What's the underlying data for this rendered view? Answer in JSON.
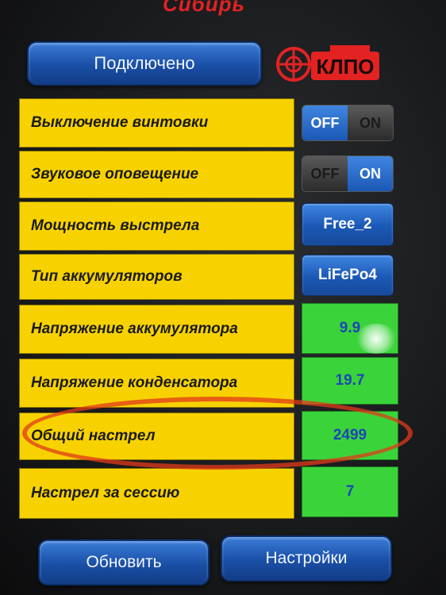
{
  "header": {
    "title": "Сибирь"
  },
  "connection": {
    "status_label": "Подключено"
  },
  "logo": {
    "text": "КЛПО"
  },
  "rows": [
    {
      "label": "Выключение винтовки",
      "type": "toggle",
      "off_label": "OFF",
      "on_label": "ON",
      "state": "off"
    },
    {
      "label": "Звуковое оповещение",
      "type": "toggle",
      "off_label": "OFF",
      "on_label": "ON",
      "state": "on"
    },
    {
      "label": "Мощность выстрела",
      "type": "button",
      "value": "Free_2"
    },
    {
      "label": "Тип аккумуляторов",
      "type": "button",
      "value": "LiFePo4"
    },
    {
      "label": "Напряжение аккумулятора",
      "type": "readout",
      "value": "9.9"
    },
    {
      "label": "Напряжение конденсатора",
      "type": "readout",
      "value": "19.7"
    },
    {
      "label": "Общий настрел",
      "type": "readout",
      "value": "2499"
    },
    {
      "label": "Настрел за сессию",
      "type": "readout",
      "value": "7"
    }
  ],
  "footer": {
    "refresh_label": "Обновить",
    "settings_label": "Настройки"
  },
  "colors": {
    "label_bg": "#f7d200",
    "readout_bg": "#3ad43a",
    "accent_blue": "#1b58b5",
    "title_red": "#e32222"
  }
}
